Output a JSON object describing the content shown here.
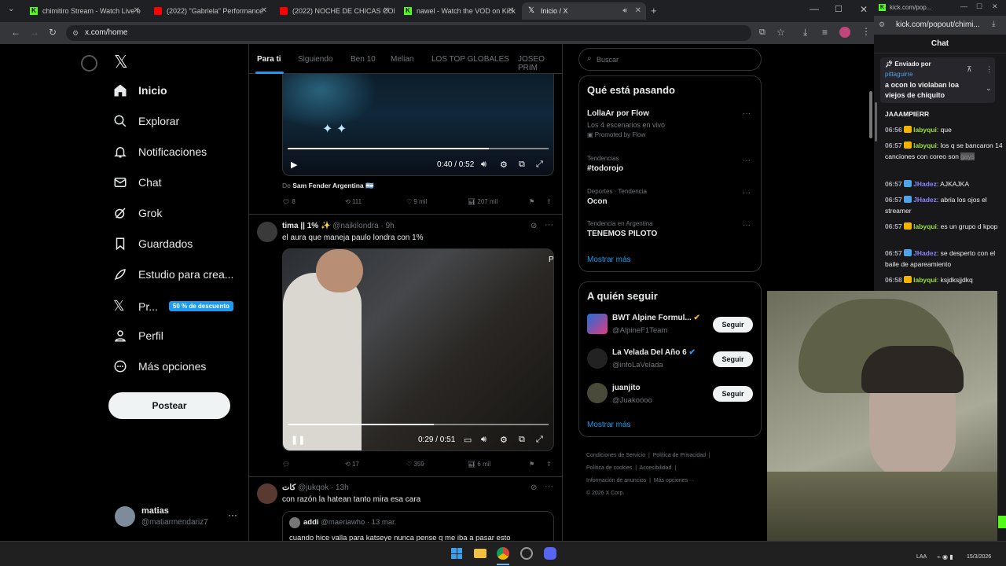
{
  "browser": {
    "tabs": [
      {
        "title": "chimitiro Stream - Watch Live o",
        "fav": "kick"
      },
      {
        "title": "(2022) \"Gabriela\" Performance",
        "fav": "youtube"
      },
      {
        "title": "(2022) NOCHE DE CHICAS CON",
        "fav": "youtube"
      },
      {
        "title": "nawel - Watch the VOD on Kick",
        "fav": "kick"
      },
      {
        "title": "Inicio / X",
        "fav": "x"
      }
    ],
    "url": "x.com/home"
  },
  "x": {
    "nav": [
      "Inicio",
      "Explorar",
      "Notificaciones",
      "Chat",
      "Grok",
      "Guardados",
      "Estudio para crea...",
      "Pr...",
      "Perfil",
      "Más opciones"
    ],
    "premium_badge": "50 % de descuento",
    "post_button": "Postear",
    "account": {
      "name": "matias",
      "handle": "@matiarmendariz7"
    },
    "feed_tabs": [
      "Para ti",
      "Siguiendo",
      "Ben 10",
      "Melian",
      "LOS TOP GLOBALES",
      "JOSEO PRIM"
    ],
    "post1": {
      "time": "0:40 / 0:52",
      "progress": 0.77,
      "source_prefix": "De",
      "source": "Sam Fender Argentina",
      "replies": "8",
      "reposts": "111",
      "likes": "9 mil",
      "views": "207 mil"
    },
    "post2": {
      "name": "tima || 1% ✨",
      "handle": "@naikilondra · 9h",
      "text": "el aura que maneja paulo londra con 1%",
      "time": "0:29 / 0:51",
      "progress": 0.56,
      "corner_text": "P",
      "replies": "",
      "reposts": "17",
      "likes": "359",
      "views": "6 mil"
    },
    "post3": {
      "name": "كات",
      "handle": "@jukqok · 13h",
      "text": "con razón la hatean tanto mira esa cara",
      "quote_name": "addi",
      "quote_handle": "@maeriawho · 13 mar.",
      "quote_text": "cuando hice valla para katseye nunca pense q me iba a pasar esto"
    },
    "search_placeholder": "Buscar",
    "trends_title": "Qué está pasando",
    "trends": [
      {
        "meta": "",
        "title": "LollaAr por Flow",
        "sub": "Los 4 escenarios en vivo",
        "promo": "Promoted by Flow"
      },
      {
        "meta": "Tendencias",
        "title": "#todorojo"
      },
      {
        "meta": "Deportes · Tendencia",
        "title": "Ocon"
      },
      {
        "meta": "Tendencia en Argentina",
        "title": "TENEMOS PILOTO"
      }
    ],
    "show_more": "Mostrar más",
    "who_title": "A quién seguir",
    "who": [
      {
        "name": "BWT Alpine Formul...",
        "handle": "@AlpineF1Team",
        "btn": "Seguir"
      },
      {
        "name": "La Velada Del Año 6",
        "handle": "@infoLaVelada",
        "btn": "Seguir"
      },
      {
        "name": "juanjito",
        "handle": "@Juakoooo",
        "btn": "Seguir"
      }
    ],
    "footer": [
      "Condiciones de Servicio",
      "Política de Privacidad",
      "Política de cookies",
      "Accesibilidad",
      "Información de anuncios",
      "Más opciones ···",
      "© 2026 X Corp."
    ]
  },
  "chat_window": {
    "url_title": "kick.com/pop...",
    "url": "kick.com/popout/chimi...",
    "title": "Chat",
    "pinned_label": "Enviado por",
    "pinned_user": "pittaguirre",
    "pinned_text": "a ocon lo violaban loa viejos de chiquito",
    "partial_line": "JAAAMPIERR",
    "messages": [
      {
        "time": "06:56",
        "user": "labyqui",
        "text": "que",
        "badge": "gold",
        "color": "#9bdf3a"
      },
      {
        "time": "06:57",
        "user": "labyqui",
        "text": "los q se bancaron 14 canciones con coreo son",
        "badge": "gold",
        "color": "#9bdf3a"
      },
      {
        "time": "06:57",
        "user": "JHadez",
        "text": "AJKAJKA",
        "badge": "blue",
        "color": "#8a84ff"
      },
      {
        "time": "06:57",
        "user": "JHadez",
        "text": "abria los ojos el streamer",
        "badge": "blue",
        "color": "#8a84ff"
      },
      {
        "time": "06:57",
        "user": "labyqui",
        "text": "es un grupo d kpop",
        "badge": "gold",
        "color": "#9bdf3a"
      },
      {
        "time": "06:57",
        "user": "JHadez",
        "text": "se desperto con el baile de apareamiento",
        "badge": "blue",
        "color": "#8a84ff"
      },
      {
        "time": "06:58",
        "user": "labyqui",
        "text": "ksjdksjjdkq",
        "badge": "gold",
        "color": "#9bdf3a"
      }
    ],
    "redacted_word": "gays"
  },
  "taskbar": {
    "lang": "LAA",
    "date": "15/3/2026"
  }
}
